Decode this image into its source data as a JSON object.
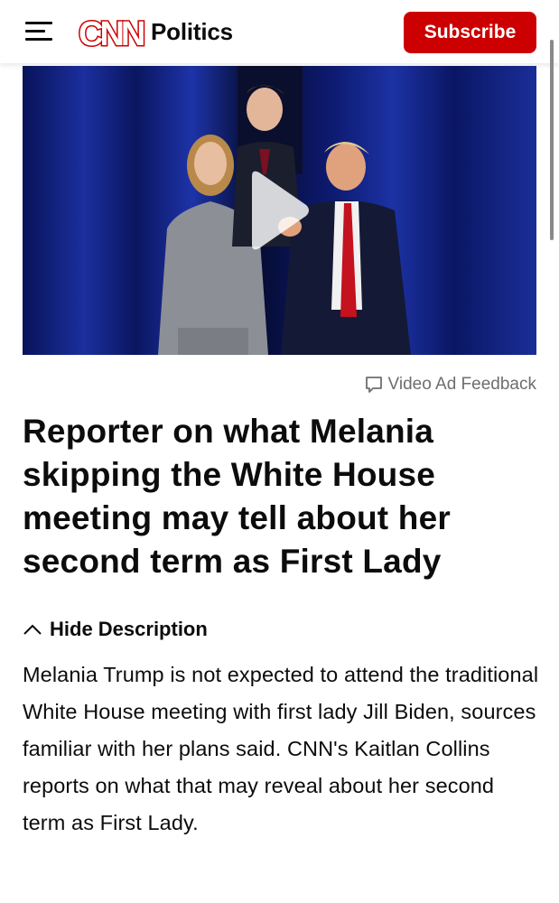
{
  "header": {
    "menu_icon": "hamburger-icon",
    "logo_text": "CNN",
    "section": "Politics",
    "subscribe_label": "Subscribe",
    "brand_color": "#cc0000"
  },
  "video": {
    "play_icon": "play-icon",
    "feedback_icon": "speech-bubble-icon",
    "feedback_label": "Video Ad Feedback"
  },
  "article": {
    "headline": "Reporter on what Melania skipping the White House meeting may tell about her second term as First Lady",
    "toggle_icon": "chevron-up-icon",
    "toggle_label": "Hide Description",
    "description": "Melania Trump is not expected to attend the traditional White House meeting with first lady Jill Biden, sources familiar with her plans said. CNN's Kaitlan Collins reports on what that may reveal about her second term as First Lady."
  }
}
